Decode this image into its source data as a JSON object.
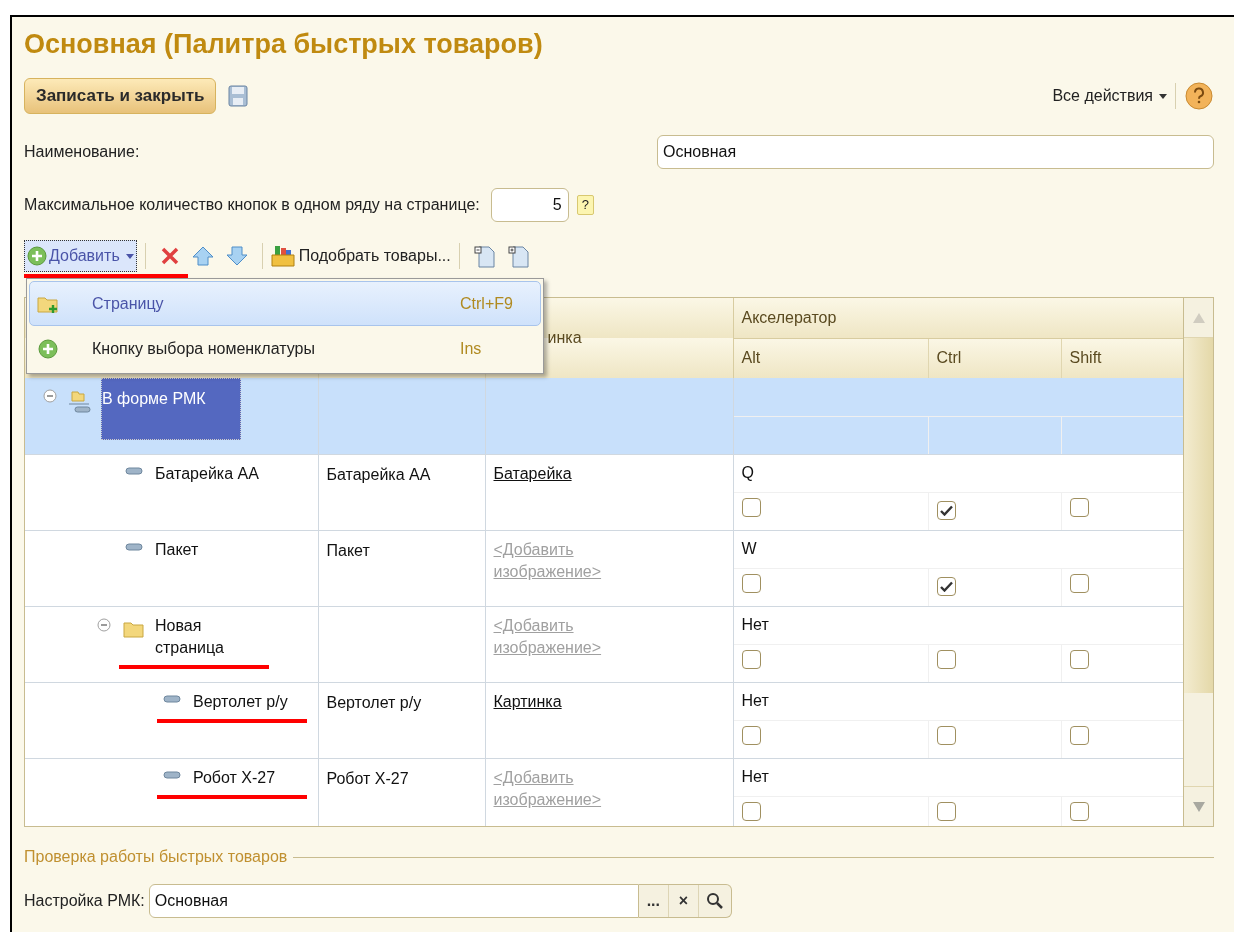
{
  "window": {
    "title": "Основная (Палитра быстрых товаров)"
  },
  "command_bar": {
    "primary_button": "Записать и закрыть",
    "all_actions": "Все действия"
  },
  "fields": [
    {
      "kind": "text",
      "label": "Наименование:",
      "value": "Основная"
    },
    {
      "kind": "number",
      "label": "Максимальное количество кнопок в одном ряду на странице:",
      "value": "5",
      "hint": "?"
    }
  ],
  "toolbar": {
    "add_button": {
      "label": "Добавить",
      "marked": true
    },
    "pick_button": "Подобрать товары..."
  },
  "add_menu": [
    {
      "kind": "page",
      "label": "Страницу",
      "shortcut": "Ctrl+F9",
      "selected": true
    },
    {
      "kind": "button",
      "label": "Кнопку выбора номенклатуры",
      "shortcut": "Ins",
      "selected": false
    }
  ],
  "table": {
    "column_3": "инка",
    "group_header": "Акселератор",
    "subcolumns": [
      "Alt",
      "Ctrl",
      "Shift"
    ],
    "rows": [
      {
        "kind": "group",
        "name": "В форме РМК",
        "selected": true,
        "expanded": true,
        "marked": false,
        "children": [
          {
            "kind": "item",
            "name": "Батарейка АА",
            "column_2": "Батарейка АА",
            "image": {
              "text": "Батарейка",
              "placeholder": false
            },
            "key": "Q",
            "alt": false,
            "ctrl": true,
            "shift": false,
            "selected": false,
            "marked": false
          },
          {
            "kind": "item",
            "name": "Пакет",
            "column_2": "Пакет",
            "image": {
              "text": "<Добавить изображение>",
              "placeholder": true
            },
            "key": "W",
            "alt": false,
            "ctrl": true,
            "shift": false,
            "selected": false,
            "marked": false
          },
          {
            "kind": "folder",
            "name": "Новая страница",
            "image": {
              "text": "<Добавить изображение>",
              "placeholder": true
            },
            "key": "Нет",
            "alt": false,
            "ctrl": false,
            "shift": false,
            "selected": false,
            "expanded": true,
            "marked": true,
            "children": [
              {
                "kind": "item",
                "name": "Вертолет р/у",
                "column_2": "Вертолет р/у",
                "image": {
                  "text": "Картинка",
                  "placeholder": false
                },
                "key": "Нет",
                "alt": false,
                "ctrl": false,
                "shift": false,
                "selected": false,
                "marked": true
              },
              {
                "kind": "item",
                "name": "Робот Х-27",
                "column_2": "Робот Х-27",
                "image": {
                  "text": "<Добавить изображение>",
                  "placeholder": true
                },
                "key": "Нет",
                "alt": false,
                "ctrl": false,
                "shift": false,
                "selected": false,
                "marked": true
              }
            ]
          }
        ]
      }
    ]
  },
  "check_section": {
    "title": "Проверка работы быстрых товаров",
    "label": "Настройка РМК:",
    "value": "Основная",
    "buttons": [
      "...",
      "×"
    ]
  }
}
